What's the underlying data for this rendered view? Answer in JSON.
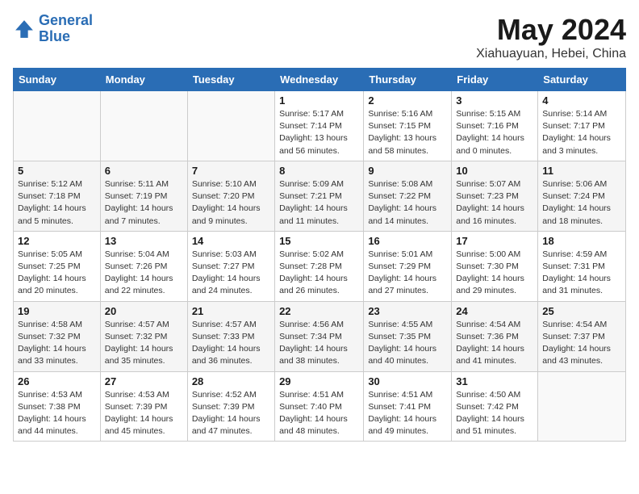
{
  "header": {
    "logo_line1": "General",
    "logo_line2": "Blue",
    "title": "May 2024",
    "subtitle": "Xiahuayuan, Hebei, China"
  },
  "weekdays": [
    "Sunday",
    "Monday",
    "Tuesday",
    "Wednesday",
    "Thursday",
    "Friday",
    "Saturday"
  ],
  "weeks": [
    [
      null,
      null,
      null,
      {
        "day": "1",
        "sunrise": "Sunrise: 5:17 AM",
        "sunset": "Sunset: 7:14 PM",
        "daylight": "Daylight: 13 hours and 56 minutes."
      },
      {
        "day": "2",
        "sunrise": "Sunrise: 5:16 AM",
        "sunset": "Sunset: 7:15 PM",
        "daylight": "Daylight: 13 hours and 58 minutes."
      },
      {
        "day": "3",
        "sunrise": "Sunrise: 5:15 AM",
        "sunset": "Sunset: 7:16 PM",
        "daylight": "Daylight: 14 hours and 0 minutes."
      },
      {
        "day": "4",
        "sunrise": "Sunrise: 5:14 AM",
        "sunset": "Sunset: 7:17 PM",
        "daylight": "Daylight: 14 hours and 3 minutes."
      }
    ],
    [
      {
        "day": "5",
        "sunrise": "Sunrise: 5:12 AM",
        "sunset": "Sunset: 7:18 PM",
        "daylight": "Daylight: 14 hours and 5 minutes."
      },
      {
        "day": "6",
        "sunrise": "Sunrise: 5:11 AM",
        "sunset": "Sunset: 7:19 PM",
        "daylight": "Daylight: 14 hours and 7 minutes."
      },
      {
        "day": "7",
        "sunrise": "Sunrise: 5:10 AM",
        "sunset": "Sunset: 7:20 PM",
        "daylight": "Daylight: 14 hours and 9 minutes."
      },
      {
        "day": "8",
        "sunrise": "Sunrise: 5:09 AM",
        "sunset": "Sunset: 7:21 PM",
        "daylight": "Daylight: 14 hours and 11 minutes."
      },
      {
        "day": "9",
        "sunrise": "Sunrise: 5:08 AM",
        "sunset": "Sunset: 7:22 PM",
        "daylight": "Daylight: 14 hours and 14 minutes."
      },
      {
        "day": "10",
        "sunrise": "Sunrise: 5:07 AM",
        "sunset": "Sunset: 7:23 PM",
        "daylight": "Daylight: 14 hours and 16 minutes."
      },
      {
        "day": "11",
        "sunrise": "Sunrise: 5:06 AM",
        "sunset": "Sunset: 7:24 PM",
        "daylight": "Daylight: 14 hours and 18 minutes."
      }
    ],
    [
      {
        "day": "12",
        "sunrise": "Sunrise: 5:05 AM",
        "sunset": "Sunset: 7:25 PM",
        "daylight": "Daylight: 14 hours and 20 minutes."
      },
      {
        "day": "13",
        "sunrise": "Sunrise: 5:04 AM",
        "sunset": "Sunset: 7:26 PM",
        "daylight": "Daylight: 14 hours and 22 minutes."
      },
      {
        "day": "14",
        "sunrise": "Sunrise: 5:03 AM",
        "sunset": "Sunset: 7:27 PM",
        "daylight": "Daylight: 14 hours and 24 minutes."
      },
      {
        "day": "15",
        "sunrise": "Sunrise: 5:02 AM",
        "sunset": "Sunset: 7:28 PM",
        "daylight": "Daylight: 14 hours and 26 minutes."
      },
      {
        "day": "16",
        "sunrise": "Sunrise: 5:01 AM",
        "sunset": "Sunset: 7:29 PM",
        "daylight": "Daylight: 14 hours and 27 minutes."
      },
      {
        "day": "17",
        "sunrise": "Sunrise: 5:00 AM",
        "sunset": "Sunset: 7:30 PM",
        "daylight": "Daylight: 14 hours and 29 minutes."
      },
      {
        "day": "18",
        "sunrise": "Sunrise: 4:59 AM",
        "sunset": "Sunset: 7:31 PM",
        "daylight": "Daylight: 14 hours and 31 minutes."
      }
    ],
    [
      {
        "day": "19",
        "sunrise": "Sunrise: 4:58 AM",
        "sunset": "Sunset: 7:32 PM",
        "daylight": "Daylight: 14 hours and 33 minutes."
      },
      {
        "day": "20",
        "sunrise": "Sunrise: 4:57 AM",
        "sunset": "Sunset: 7:32 PM",
        "daylight": "Daylight: 14 hours and 35 minutes."
      },
      {
        "day": "21",
        "sunrise": "Sunrise: 4:57 AM",
        "sunset": "Sunset: 7:33 PM",
        "daylight": "Daylight: 14 hours and 36 minutes."
      },
      {
        "day": "22",
        "sunrise": "Sunrise: 4:56 AM",
        "sunset": "Sunset: 7:34 PM",
        "daylight": "Daylight: 14 hours and 38 minutes."
      },
      {
        "day": "23",
        "sunrise": "Sunrise: 4:55 AM",
        "sunset": "Sunset: 7:35 PM",
        "daylight": "Daylight: 14 hours and 40 minutes."
      },
      {
        "day": "24",
        "sunrise": "Sunrise: 4:54 AM",
        "sunset": "Sunset: 7:36 PM",
        "daylight": "Daylight: 14 hours and 41 minutes."
      },
      {
        "day": "25",
        "sunrise": "Sunrise: 4:54 AM",
        "sunset": "Sunset: 7:37 PM",
        "daylight": "Daylight: 14 hours and 43 minutes."
      }
    ],
    [
      {
        "day": "26",
        "sunrise": "Sunrise: 4:53 AM",
        "sunset": "Sunset: 7:38 PM",
        "daylight": "Daylight: 14 hours and 44 minutes."
      },
      {
        "day": "27",
        "sunrise": "Sunrise: 4:53 AM",
        "sunset": "Sunset: 7:39 PM",
        "daylight": "Daylight: 14 hours and 45 minutes."
      },
      {
        "day": "28",
        "sunrise": "Sunrise: 4:52 AM",
        "sunset": "Sunset: 7:39 PM",
        "daylight": "Daylight: 14 hours and 47 minutes."
      },
      {
        "day": "29",
        "sunrise": "Sunrise: 4:51 AM",
        "sunset": "Sunset: 7:40 PM",
        "daylight": "Daylight: 14 hours and 48 minutes."
      },
      {
        "day": "30",
        "sunrise": "Sunrise: 4:51 AM",
        "sunset": "Sunset: 7:41 PM",
        "daylight": "Daylight: 14 hours and 49 minutes."
      },
      {
        "day": "31",
        "sunrise": "Sunrise: 4:50 AM",
        "sunset": "Sunset: 7:42 PM",
        "daylight": "Daylight: 14 hours and 51 minutes."
      },
      null
    ]
  ]
}
